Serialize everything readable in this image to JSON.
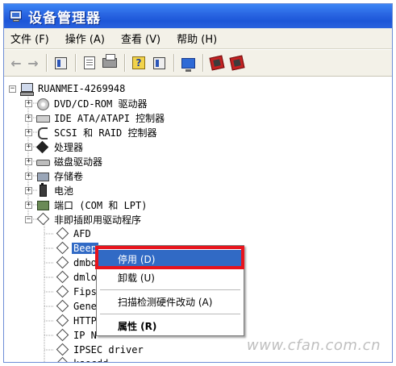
{
  "window": {
    "title": "设备管理器"
  },
  "menubar": [
    {
      "label": "文件 (F)"
    },
    {
      "label": "操作 (A)"
    },
    {
      "label": "查看 (V)"
    },
    {
      "label": "帮助 (H)"
    }
  ],
  "toolbar": {
    "icons": [
      "back-arrow-icon",
      "forward-arrow-icon",
      "panel-icon",
      "properties-icon",
      "printer-icon",
      "help-icon",
      "panel-alt-icon",
      "monitor-icon",
      "uninstall-icon",
      "disable-icon"
    ]
  },
  "tree": {
    "root": "RUANMEI-4269948",
    "categories": [
      {
        "label": "DVD/CD-ROM 驱动器",
        "icon": "cd-drive-icon"
      },
      {
        "label": "IDE ATA/ATAPI 控制器",
        "icon": "ide-controller-icon"
      },
      {
        "label": "SCSI 和 RAID 控制器",
        "icon": "scsi-controller-icon"
      },
      {
        "label": "处理器",
        "icon": "processor-icon"
      },
      {
        "label": "磁盘驱动器",
        "icon": "disk-drive-icon"
      },
      {
        "label": "存储卷",
        "icon": "storage-volume-icon"
      },
      {
        "label": "电池",
        "icon": "battery-icon"
      },
      {
        "label": "端口 (COM 和 LPT)",
        "icon": "port-icon"
      },
      {
        "label": "非即插即用驱动程序",
        "icon": "non-pnp-driver-icon"
      }
    ],
    "drivers": [
      {
        "label": "AFD"
      },
      {
        "label": "Beep",
        "selected": true
      },
      {
        "label": "dmbo"
      },
      {
        "label": "dmlo"
      },
      {
        "label": "Fips"
      },
      {
        "label": "Gene"
      },
      {
        "label": "HTTP"
      },
      {
        "label": "IP N"
      },
      {
        "label": "IPSEC driver"
      },
      {
        "label": "ksecdd"
      }
    ]
  },
  "context_menu": {
    "items": [
      {
        "label": "停用 (D)",
        "highlighted": true
      },
      {
        "label": "卸载 (U)"
      },
      {
        "label": "扫描检测硬件改动 (A)"
      },
      {
        "label": "属性 (R)",
        "bold": true
      }
    ]
  },
  "watermark": "www.cfan.com.cn",
  "colors": {
    "titlebar": "#2a67e3",
    "selection": "#316ac5",
    "highlight_border": "#e8141d"
  }
}
